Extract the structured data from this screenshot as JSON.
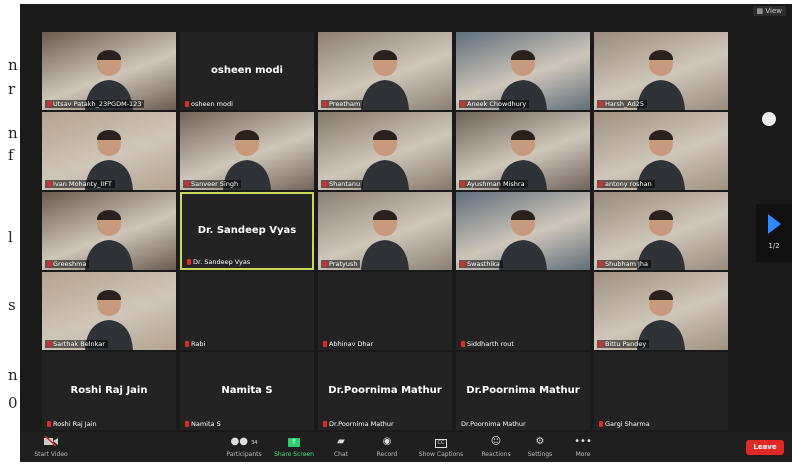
{
  "margin_text": [
    "n",
    "r",
    "n",
    "f",
    "l",
    "s",
    "n",
    "0"
  ],
  "view_label": "View",
  "tiles": [
    {
      "name": "Utsav Patakh_23PGDM-123",
      "type": "video"
    },
    {
      "name": "osheen modi",
      "type": "name",
      "display": "osheen modi"
    },
    {
      "name": "Preetham",
      "type": "video"
    },
    {
      "name": "Aneek Chowdhury",
      "type": "video"
    },
    {
      "name": "Harsh_Ad25",
      "type": "video"
    },
    {
      "name": "Ivan Mohanty_IIFT",
      "type": "video"
    },
    {
      "name": "Sanveer Singh",
      "type": "video"
    },
    {
      "name": "Shantanu",
      "type": "video"
    },
    {
      "name": "Ayushman Mishra",
      "type": "video"
    },
    {
      "name": "antony roshan",
      "type": "video"
    },
    {
      "name": "Greeshma",
      "type": "video"
    },
    {
      "name": "Dr. Sandeep Vyas",
      "type": "name",
      "display": "Dr. Sandeep Vyas",
      "active": true
    },
    {
      "name": "Pratyush",
      "type": "video"
    },
    {
      "name": "Swasthika",
      "type": "video"
    },
    {
      "name": "Shubham Jha",
      "type": "video"
    },
    {
      "name": "Sarthak Belnkar",
      "type": "video"
    },
    {
      "name": "Rabi",
      "type": "blank"
    },
    {
      "name": "Abhinav Dhar",
      "type": "blank"
    },
    {
      "name": "Siddharth rout",
      "type": "blank"
    },
    {
      "name": "Bittu Pandey",
      "type": "video"
    },
    {
      "name": "Roshi Raj Jain",
      "type": "name",
      "display": "Roshi Raj Jain"
    },
    {
      "name": "Namita S",
      "type": "name",
      "display": "Namita S"
    },
    {
      "name": "Dr.Poornima Mathur",
      "type": "name",
      "display": "Dr.Poornima Mathur"
    },
    {
      "name": "Dr.Poornima Mathur",
      "type": "name",
      "display": "Dr.Poornima Mathur",
      "muted": false
    },
    {
      "name": "Gargi Sharma",
      "type": "blank"
    }
  ],
  "page_indicator": "1/2",
  "toolbar": {
    "start_video": "Start Video",
    "participants": "Participants",
    "participants_count": "34",
    "share_screen": "Share Screen",
    "chat": "Chat",
    "record": "Record",
    "show_captions": "Show Captions",
    "reactions": "Reactions",
    "settings": "Settings",
    "more": "More",
    "leave": "Leave"
  },
  "colors": {
    "share_green": "#2ecc71",
    "leave_red": "#e02828",
    "active_border": "#c9d65a",
    "nav_blue": "#2d8cff"
  }
}
